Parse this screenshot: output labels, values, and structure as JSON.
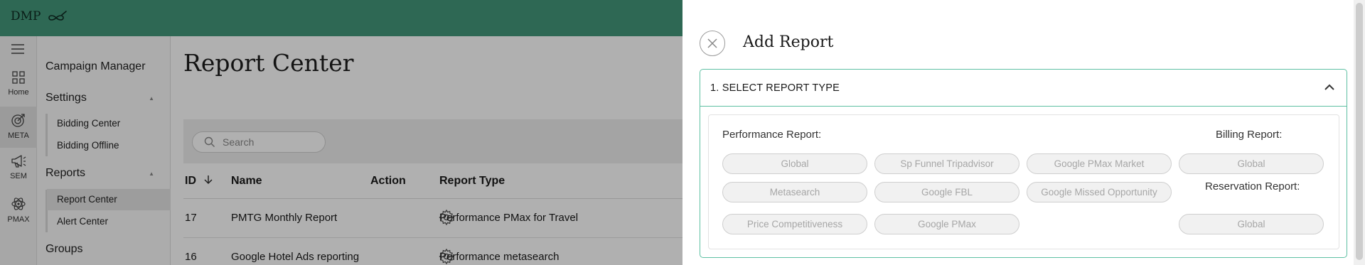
{
  "app": {
    "logo_text": "DMP",
    "colors": {
      "brand_green": "#43977a",
      "accent_border": "#5ec0a3"
    }
  },
  "rail": {
    "items": [
      {
        "label": "Home",
        "icon": "grid-icon"
      },
      {
        "label": "META",
        "icon": "target-icon"
      },
      {
        "label": "SEM",
        "icon": "megaphone-icon"
      },
      {
        "label": "PMAX",
        "icon": "atom-icon"
      }
    ]
  },
  "sidenav": {
    "campaign_manager": "Campaign Manager",
    "settings": {
      "label": "Settings",
      "items": [
        "Bidding Center",
        "Bidding Offline"
      ]
    },
    "reports": {
      "label": "Reports",
      "items": [
        "Report Center",
        "Alert Center"
      ]
    },
    "groups": "Groups"
  },
  "page": {
    "title": "Report Center",
    "search_placeholder": "Search",
    "columns": {
      "id": "ID",
      "name": "Name",
      "action": "Action",
      "report_type": "Report Type"
    },
    "rows": [
      {
        "id": "17",
        "name": "PMTG Monthly Report",
        "report_type": "Performance PMax for Travel"
      },
      {
        "id": "16",
        "name": "Google Hotel Ads reporting",
        "report_type": "Performance metasearch"
      }
    ]
  },
  "drawer": {
    "title": "Add Report",
    "section_label": "1. SELECT REPORT TYPE",
    "performance_label": "Performance Report:",
    "billing_label": "Billing Report:",
    "reservation_label": "Reservation Report:",
    "performance_options": [
      "Global",
      "Sp Funnel Tripadvisor",
      "Google PMax Market",
      "Metasearch",
      "Google FBL",
      "Google Missed Opportunity",
      "Price Competitiveness",
      "Google PMax"
    ],
    "billing_options": [
      "Global"
    ],
    "reservation_options": [
      "Global"
    ]
  }
}
